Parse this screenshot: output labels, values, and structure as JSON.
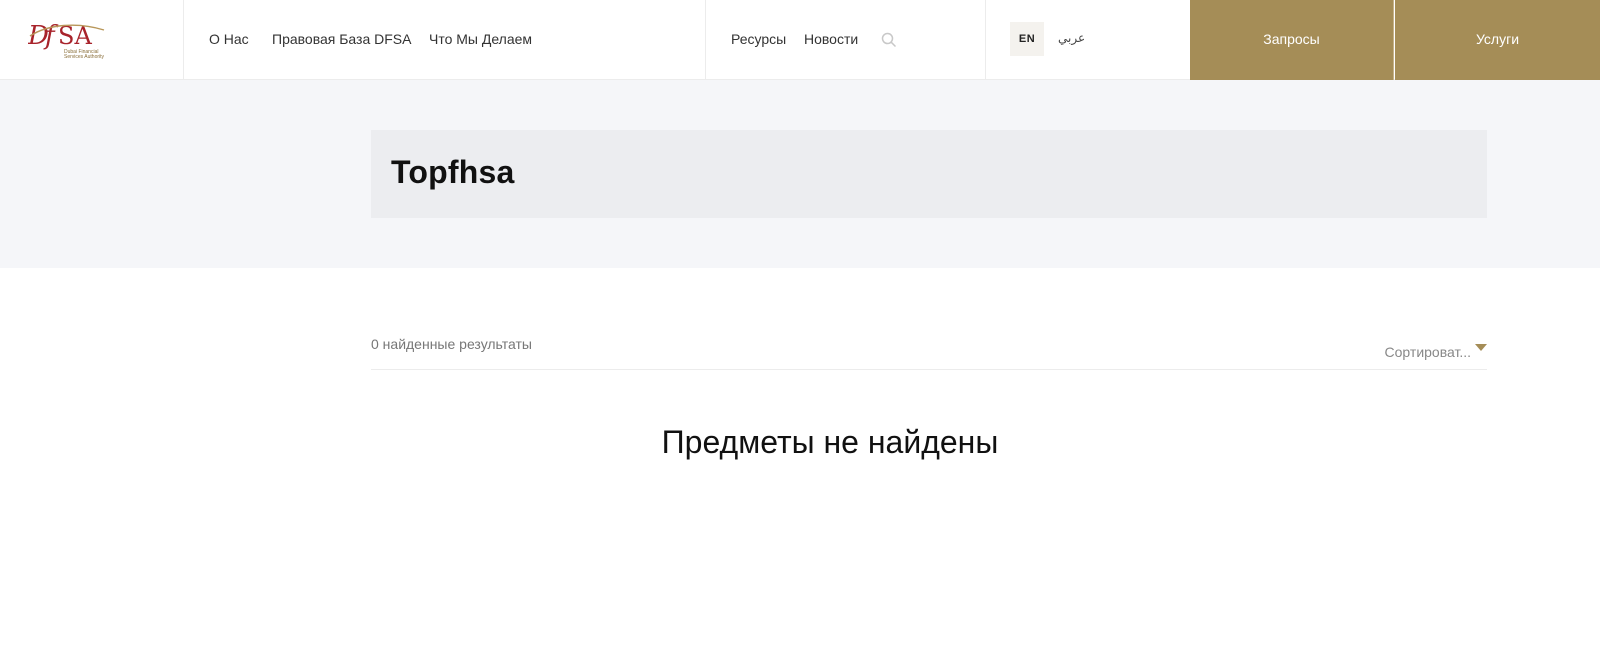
{
  "brand": {
    "logo_text": "DFSA",
    "logo_subtitle": "Dubai Financial Services Authority",
    "logo_color": "#a8232b",
    "accent_color": "#a58d57"
  },
  "nav": {
    "main": [
      {
        "label": "О Нас"
      },
      {
        "label": "Правовая База DFSA"
      },
      {
        "label": "Что Мы Делаем"
      }
    ],
    "secondary": [
      {
        "label": "Ресурсы"
      },
      {
        "label": "Новости"
      }
    ],
    "search_icon": "search-icon"
  },
  "language": {
    "current": "EN",
    "alternate": "عربي"
  },
  "cta": {
    "requests": "Запросы",
    "services": "Услуги"
  },
  "page": {
    "title": "Topfhsa"
  },
  "results": {
    "count_text": "0 найденные результаты",
    "sort_label": "Сортироват...",
    "empty_text": "Предметы не найдены"
  }
}
